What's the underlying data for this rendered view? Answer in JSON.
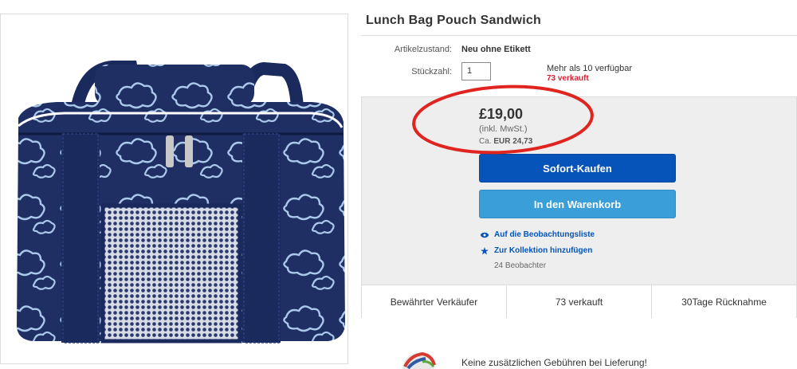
{
  "product": {
    "title": "Lunch Bag Pouch Sandwich",
    "condition_label": "Artikelzustand:",
    "condition_value": "Neu ohne Etikett",
    "quantity_label": "Stückzahl:",
    "quantity_value": "1",
    "availability": "Mehr als 10 verfügbar",
    "sold_count": "73 verkauft"
  },
  "pricing": {
    "price": "£19,00",
    "vat_note": "(inkl. MwSt.)",
    "converted_prefix": "Ca.",
    "converted_value": "EUR 24,73"
  },
  "actions": {
    "buy_now": "Sofort-Kaufen",
    "add_to_cart": "In den Warenkorb",
    "watchlist": "Auf die Beobachtungsliste",
    "collection": "Zur Kollektion hinzufügen",
    "watchers": "24 Beobachter"
  },
  "info_bar": {
    "seller": "Bewährter Verkäufer",
    "sold": "73 verkauft",
    "returns": "30Tage Rücknahme"
  },
  "shipping": {
    "note": "Keine zusätzlichen Gebühren bei Lieferung!"
  },
  "colors": {
    "primary_button": "#0654ba",
    "secondary_button": "#3a9ed9",
    "sold_red": "#dd1e31",
    "annotation_ring": "#e0241f",
    "bag_navy": "#1f2f63",
    "cloud_light": "#a9c8ea"
  },
  "icons": [
    "eye-icon",
    "star-icon",
    "globe-icon"
  ]
}
